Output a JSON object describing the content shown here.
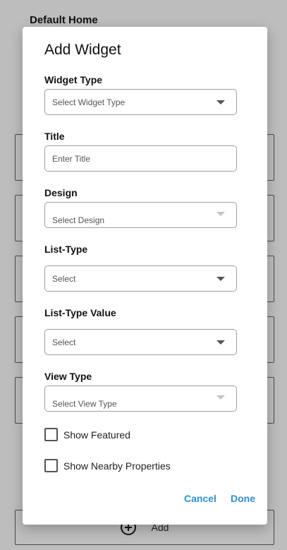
{
  "background": {
    "page_title": "Default Home",
    "add_label": "Add"
  },
  "dialog": {
    "title": "Add Widget",
    "fields": [
      {
        "label": "Widget Type",
        "placeholder": "Select Widget Type",
        "type": "select",
        "caret": "dark"
      },
      {
        "label": "Title",
        "placeholder": "Enter Title",
        "type": "text"
      },
      {
        "label": "Design",
        "placeholder": "Select Design",
        "type": "select",
        "caret": "light"
      },
      {
        "label": "List-Type",
        "placeholder": "Select",
        "type": "select",
        "caret": "dark"
      },
      {
        "label": "List-Type Value",
        "placeholder": "Select",
        "type": "select",
        "caret": "dark"
      },
      {
        "label": "View Type",
        "placeholder": "Select View Type",
        "type": "select",
        "caret": "light"
      }
    ],
    "checkboxes": [
      {
        "label": "Show Featured",
        "checked": false
      },
      {
        "label": "Show Nearby Properties",
        "checked": false
      }
    ],
    "actions": {
      "cancel": "Cancel",
      "done": "Done",
      "color": "#2d8fd5"
    }
  }
}
